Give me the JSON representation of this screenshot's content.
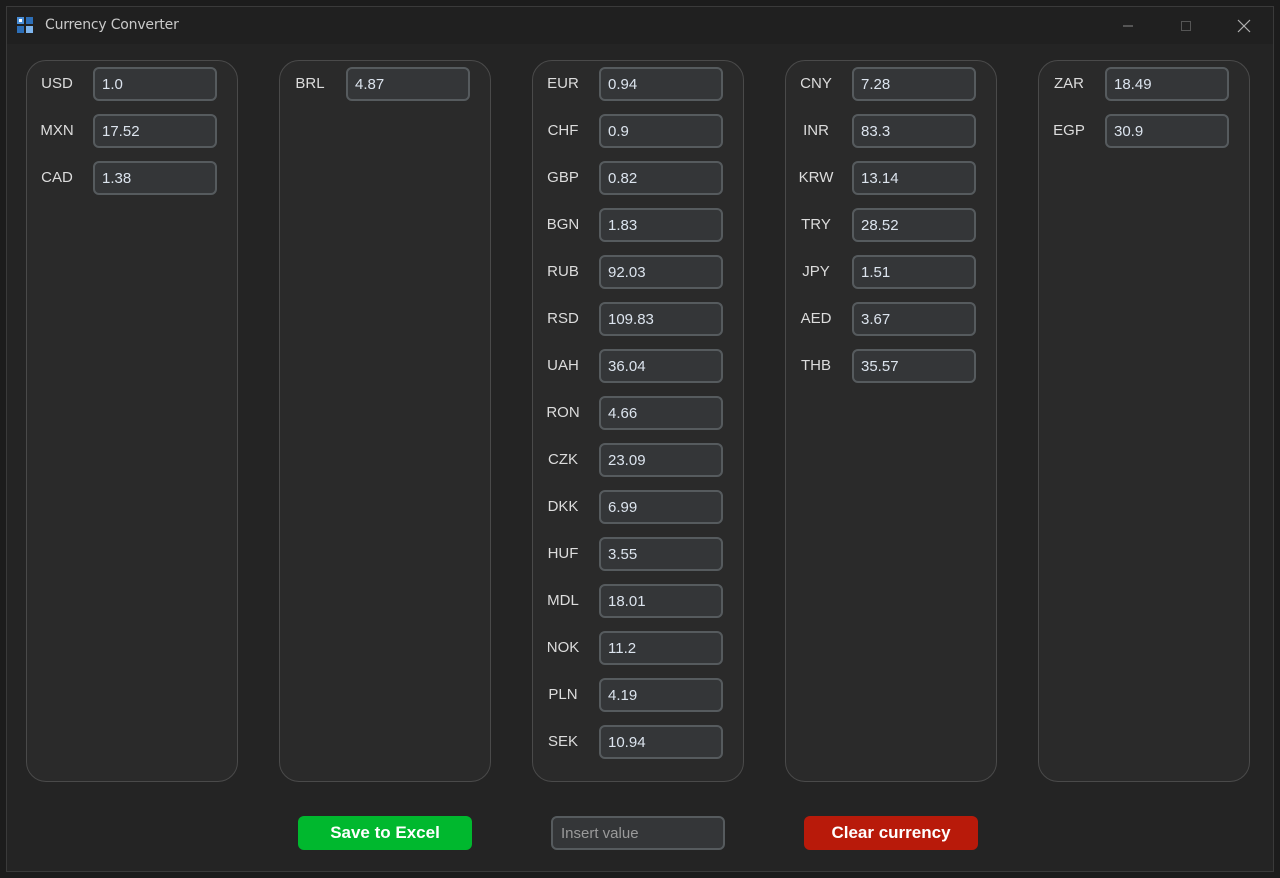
{
  "window": {
    "title": "Currency Converter"
  },
  "columns": [
    {
      "rows": [
        {
          "code": "USD",
          "value": "1.0"
        },
        {
          "code": "MXN",
          "value": "17.52"
        },
        {
          "code": "CAD",
          "value": "1.38"
        }
      ]
    },
    {
      "rows": [
        {
          "code": "BRL",
          "value": "4.87"
        }
      ]
    },
    {
      "rows": [
        {
          "code": "EUR",
          "value": "0.94"
        },
        {
          "code": "CHF",
          "value": "0.9"
        },
        {
          "code": "GBP",
          "value": "0.82"
        },
        {
          "code": "BGN",
          "value": "1.83"
        },
        {
          "code": "RUB",
          "value": "92.03"
        },
        {
          "code": "RSD",
          "value": "109.83"
        },
        {
          "code": "UAH",
          "value": "36.04"
        },
        {
          "code": "RON",
          "value": "4.66"
        },
        {
          "code": "CZK",
          "value": "23.09"
        },
        {
          "code": "DKK",
          "value": "6.99"
        },
        {
          "code": "HUF",
          "value": "3.55"
        },
        {
          "code": "MDL",
          "value": "18.01"
        },
        {
          "code": "NOK",
          "value": "11.2"
        },
        {
          "code": "PLN",
          "value": "4.19"
        },
        {
          "code": "SEK",
          "value": "10.94"
        }
      ]
    },
    {
      "rows": [
        {
          "code": "CNY",
          "value": "7.28"
        },
        {
          "code": "INR",
          "value": "83.3"
        },
        {
          "code": "KRW",
          "value": "13.14"
        },
        {
          "code": "TRY",
          "value": "28.52"
        },
        {
          "code": "JPY",
          "value": "1.51"
        },
        {
          "code": "AED",
          "value": "3.67"
        },
        {
          "code": "THB",
          "value": "35.57"
        }
      ]
    },
    {
      "rows": [
        {
          "code": "ZAR",
          "value": "18.49"
        },
        {
          "code": "EGP",
          "value": "30.9"
        }
      ]
    }
  ],
  "actions": {
    "save_label": "Save to Excel",
    "insert_placeholder": "Insert value",
    "insert_value": "",
    "clear_label": "Clear currency"
  },
  "colors": {
    "save_button": "#00b82e",
    "clear_button": "#b81a0a",
    "background": "#242424"
  }
}
